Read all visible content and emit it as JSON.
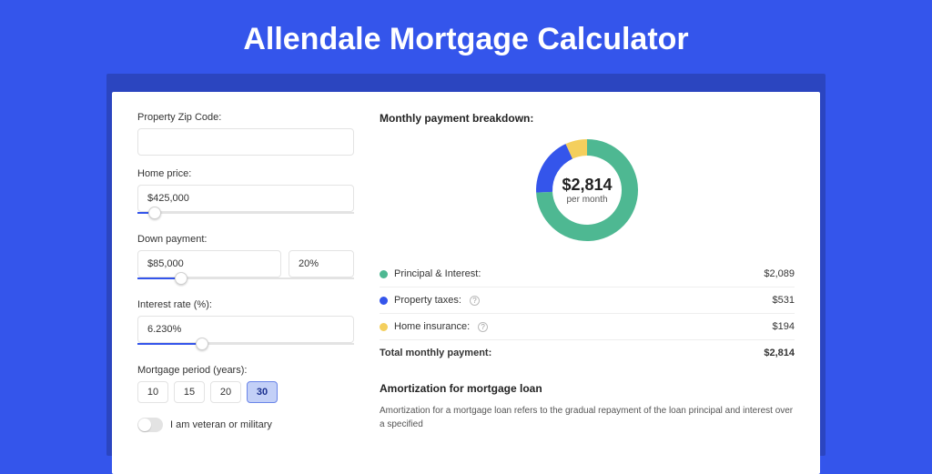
{
  "page_title": "Allendale Mortgage Calculator",
  "form": {
    "zip_label": "Property Zip Code:",
    "zip_value": "",
    "home_price_label": "Home price:",
    "home_price_value": "$425,000",
    "home_price_slider_pct": 8,
    "down_payment_label": "Down payment:",
    "down_payment_value": "$85,000",
    "down_payment_pct": "20%",
    "down_payment_slider_pct": 20,
    "interest_label": "Interest rate (%):",
    "interest_value": "6.230%",
    "interest_slider_pct": 30,
    "period_label": "Mortgage period (years):",
    "period_options": [
      "10",
      "15",
      "20",
      "30"
    ],
    "period_active": "30",
    "veteran_label": "I am veteran or military"
  },
  "breakdown": {
    "title": "Monthly payment breakdown:",
    "center_amount": "$2,814",
    "center_per": "per month",
    "rows": [
      {
        "label": "Principal & Interest:",
        "value": "$2,089",
        "color": "#4eb892",
        "help": false
      },
      {
        "label": "Property taxes:",
        "value": "$531",
        "color": "#3455eb",
        "help": true
      },
      {
        "label": "Home insurance:",
        "value": "$194",
        "color": "#f4cf5d",
        "help": true
      }
    ],
    "total_label": "Total monthly payment:",
    "total_value": "$2,814"
  },
  "amort": {
    "title": "Amortization for mortgage loan",
    "text": "Amortization for a mortgage loan refers to the gradual repayment of the loan principal and interest over a specified"
  },
  "chart_data": {
    "type": "pie",
    "title": "Monthly payment breakdown",
    "series": [
      {
        "name": "Principal & Interest",
        "value": 2089,
        "color": "#4eb892"
      },
      {
        "name": "Property taxes",
        "value": 531,
        "color": "#3455eb"
      },
      {
        "name": "Home insurance",
        "value": 194,
        "color": "#f4cf5d"
      }
    ],
    "total": 2814,
    "center_label": "$2,814 per month"
  }
}
